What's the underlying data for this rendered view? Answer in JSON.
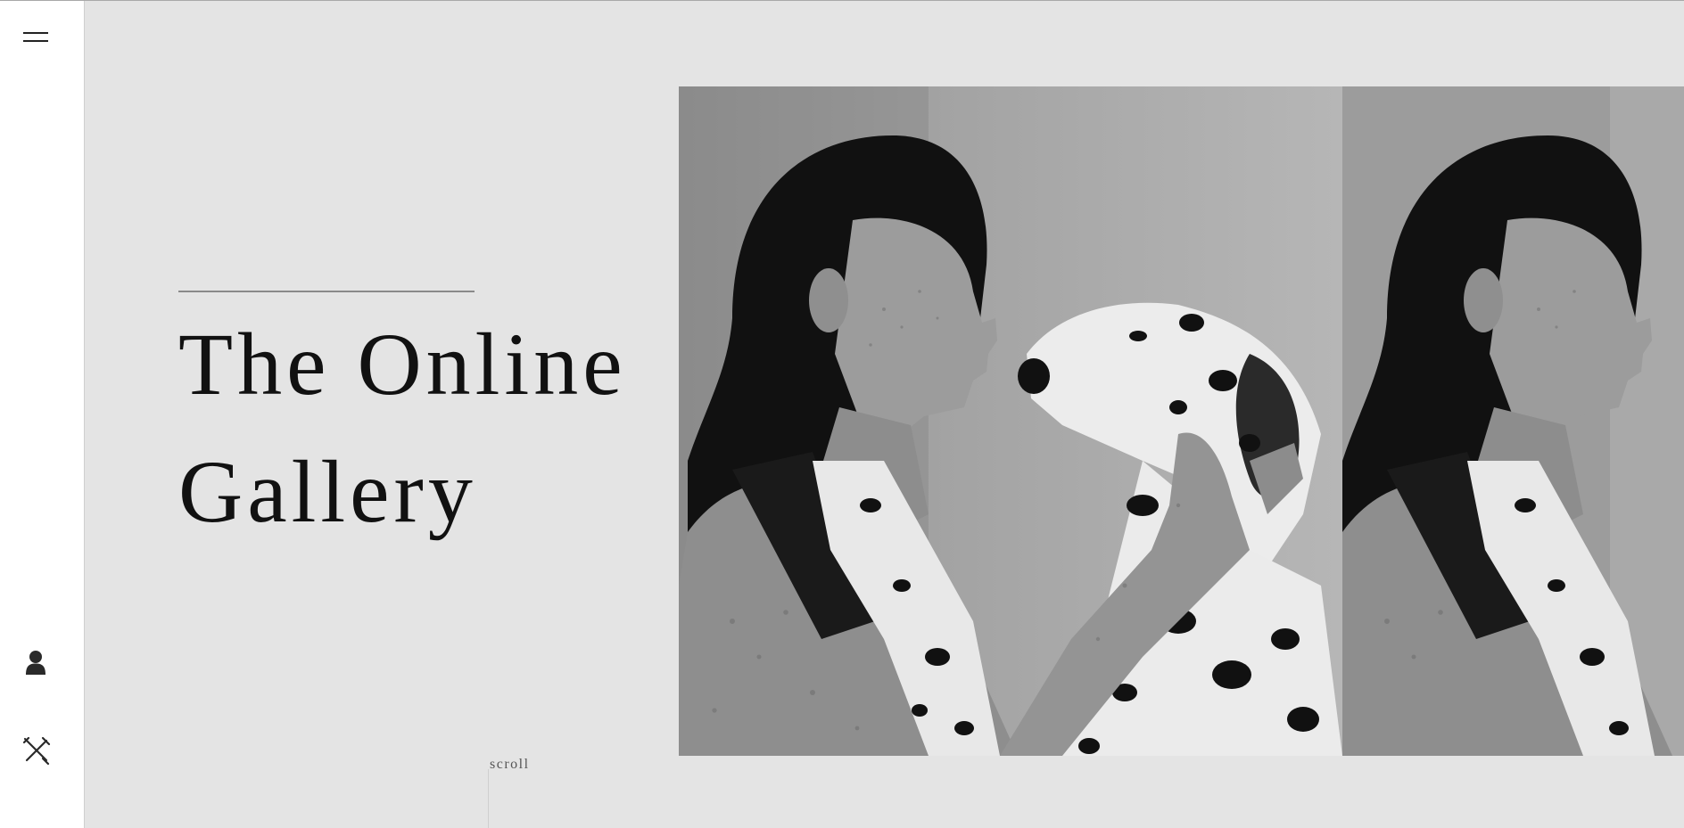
{
  "sidebar": {
    "menu_icon": "hamburger-menu-icon",
    "user_icon": "user-icon",
    "tools_icon": "tools-icon"
  },
  "hero": {
    "title_line1": "The Online",
    "title_line2": "Gallery"
  },
  "scroll": {
    "label": "scroll"
  },
  "gallery": {
    "photos": [
      {
        "description": "Black and white photo of a freckled woman facing a Dalmatian dog"
      },
      {
        "description": "Black and white photo of a freckled woman with a Dalmatian (repeated slide)"
      }
    ]
  },
  "colors": {
    "background": "#e4e4e4",
    "sidebar": "#ffffff",
    "text": "#111111",
    "rule": "#8a8a8a"
  }
}
